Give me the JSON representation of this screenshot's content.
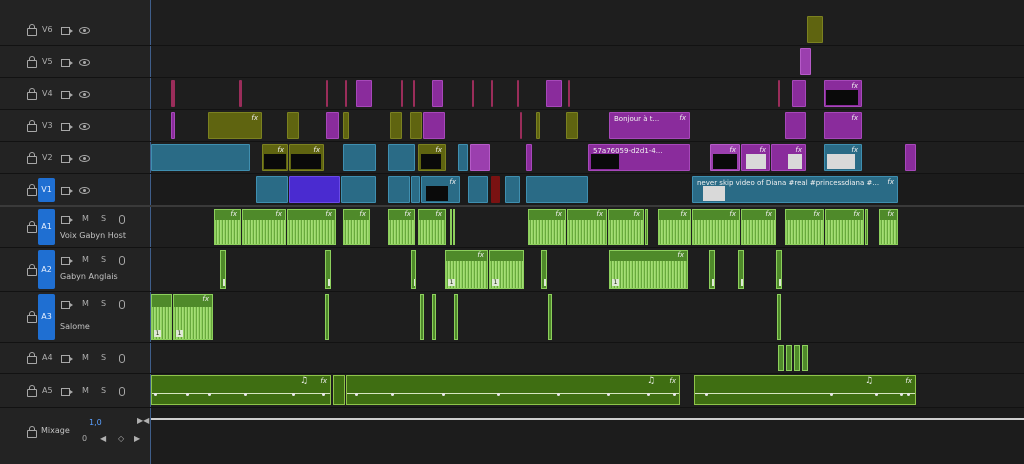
{
  "tracks": {
    "video": [
      {
        "id": "V6",
        "label": "V6"
      },
      {
        "id": "V5",
        "label": "V5"
      },
      {
        "id": "V4",
        "label": "V4"
      },
      {
        "id": "V3",
        "label": "V3"
      },
      {
        "id": "V2",
        "label": "V2"
      },
      {
        "id": "V1",
        "label": "V1",
        "target": "V1"
      }
    ],
    "audio": [
      {
        "id": "A1",
        "target": "A1",
        "name": "Voix Gabyn Host",
        "m": "M",
        "s": "S"
      },
      {
        "id": "A2",
        "target": "A2",
        "name": "Gabyn Anglais",
        "m": "M",
        "s": "S"
      },
      {
        "id": "A3",
        "target": "A3",
        "name": "Salome",
        "m": "M",
        "s": "S"
      },
      {
        "id": "A4",
        "label": "A4",
        "m": "M",
        "s": "S"
      },
      {
        "id": "A5",
        "label": "A5",
        "m": "M",
        "s": "S"
      }
    ],
    "mix": {
      "label": "Mixage",
      "value": "1,0",
      "zero": "0"
    }
  },
  "clips": {
    "v3_bonjour": "Bonjour à t...",
    "v2_id": "57a76059-d2d1-4...",
    "v1_never": "never skip video of Diana #real #princessdiana #...",
    "fx": "fx",
    "one": "1",
    "note": "♫"
  },
  "colors": {
    "selected_track": "#1f6fd2",
    "audio_clip": "#4f8a2a",
    "video_teal": "#2a6b86",
    "video_purple": "#8a2c9c"
  }
}
